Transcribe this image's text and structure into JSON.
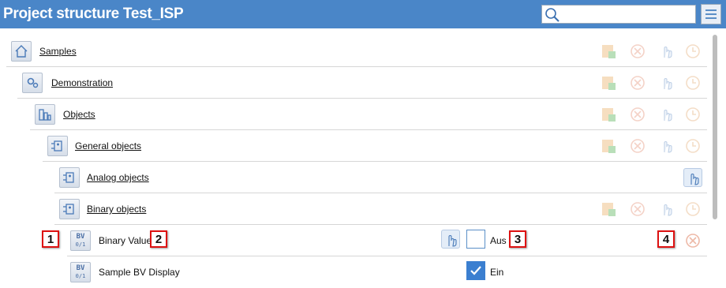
{
  "header": {
    "title": "Project structure Test_ISP",
    "search_placeholder": ""
  },
  "tree": [
    {
      "label": "Samples",
      "icon": "home-icon"
    },
    {
      "label": "Demonstration",
      "icon": "gears-icon"
    },
    {
      "label": "Objects",
      "icon": "building-icon"
    },
    {
      "label": "General objects",
      "icon": "object-group-icon"
    },
    {
      "label": "Analog objects",
      "icon": "object-group-icon"
    },
    {
      "label": "Binary objects",
      "icon": "object-group-icon"
    }
  ],
  "binary_value": {
    "icon_top": "BV",
    "icon_bottom": "0/1",
    "label": "Binary Value",
    "state": "Aus",
    "checked": false
  },
  "sample_bv_display": {
    "icon_top": "BV",
    "icon_bottom": "0/1",
    "label": "Sample BV Display",
    "state": "Ein",
    "checked": true
  },
  "markers": [
    "1",
    "2",
    "3",
    "4"
  ],
  "colors": {
    "header": "#4a86c8",
    "accent": "#3b7fd0",
    "marker_border": "#dd1111"
  }
}
